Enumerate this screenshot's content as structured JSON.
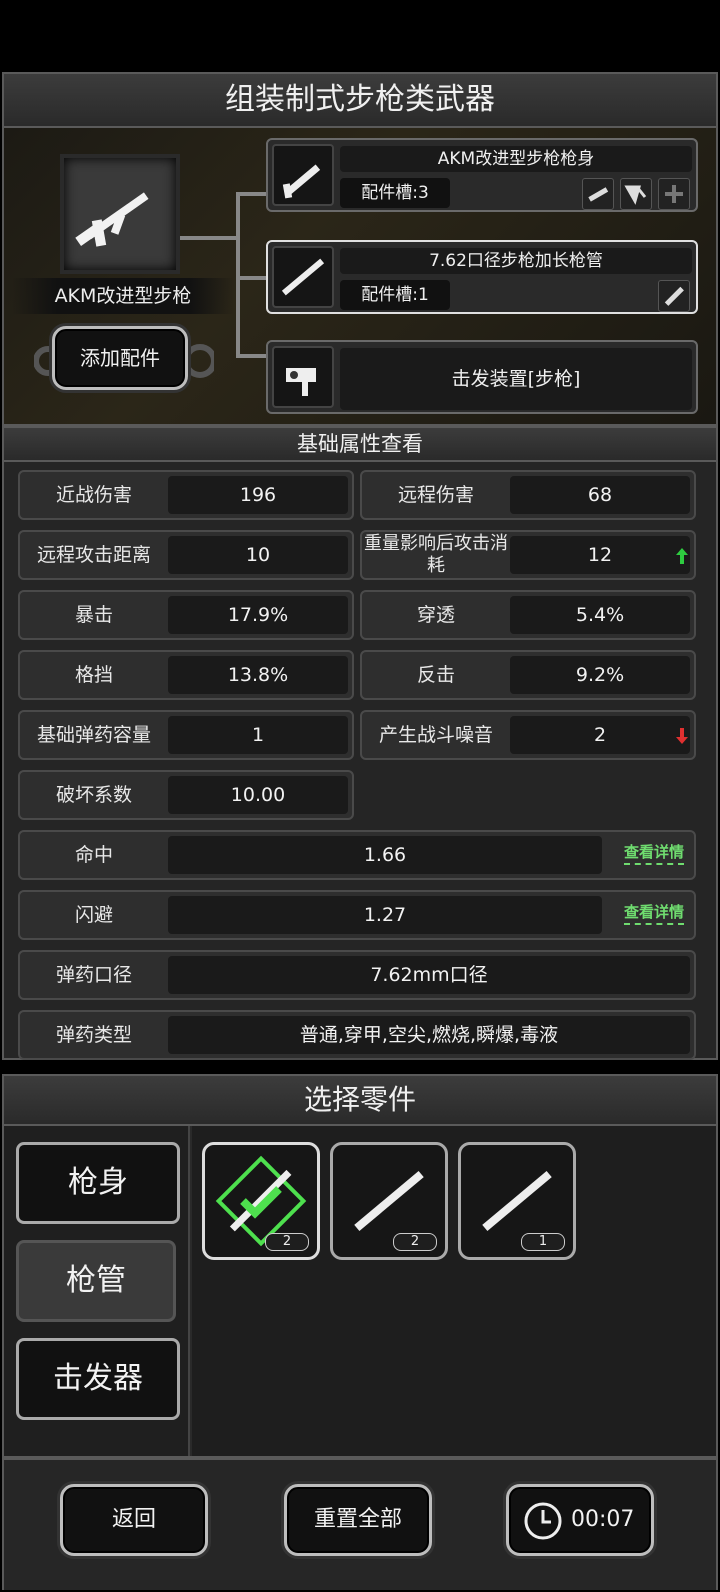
{
  "title": "组装制式步枪类武器",
  "weapon": {
    "name": "AKM改进型步枪",
    "add_parts_label": "添加配件"
  },
  "slots": [
    {
      "name": "AKM改进型步枪枪身",
      "slot_label": "配件槽:3"
    },
    {
      "name": "7.62口径步枪加长枪管",
      "slot_label": "配件槽:1"
    },
    {
      "name": "击发装置[步枪]"
    }
  ],
  "stats_header": "基础属性查看",
  "stats": {
    "melee_damage": {
      "label": "近战伤害",
      "value": "196"
    },
    "ranged_damage": {
      "label": "远程伤害",
      "value": "68"
    },
    "ranged_distance": {
      "label": "远程攻击距离",
      "value": "10"
    },
    "weight_cost": {
      "label": "重量影响后攻击消耗",
      "value": "12",
      "trend": "up"
    },
    "crit": {
      "label": "暴击",
      "value": "17.9%"
    },
    "pierce": {
      "label": "穿透",
      "value": "5.4%"
    },
    "block": {
      "label": "格挡",
      "value": "13.8%"
    },
    "counter": {
      "label": "反击",
      "value": "9.2%"
    },
    "ammo_capacity": {
      "label": "基础弹药容量",
      "value": "1"
    },
    "noise": {
      "label": "产生战斗噪音",
      "value": "2",
      "trend": "down"
    },
    "destruction": {
      "label": "破坏系数",
      "value": "10.00"
    },
    "hit": {
      "label": "命中",
      "value": "1.66",
      "detail": "查看详情"
    },
    "dodge": {
      "label": "闪避",
      "value": "1.27",
      "detail": "查看详情"
    },
    "caliber": {
      "label": "弹药口径",
      "value": "7.62mm口径"
    },
    "ammo_type": {
      "label": "弹药类型",
      "value": "普通,穿甲,空尖,燃烧,瞬爆,毒液"
    }
  },
  "select_header": "选择零件",
  "tabs": [
    {
      "label": "枪身",
      "active": false
    },
    {
      "label": "枪管",
      "active": true
    },
    {
      "label": "击发器",
      "active": false
    }
  ],
  "parts": [
    {
      "count": "2",
      "selected": true
    },
    {
      "count": "2",
      "selected": false
    },
    {
      "count": "1",
      "selected": false
    }
  ],
  "footer": {
    "back_label": "返回",
    "reset_label": "重置全部",
    "timer": "00:07"
  },
  "colors": {
    "accent_green": "#6fdc6f",
    "up": "#2ecc40",
    "down": "#e03030"
  }
}
